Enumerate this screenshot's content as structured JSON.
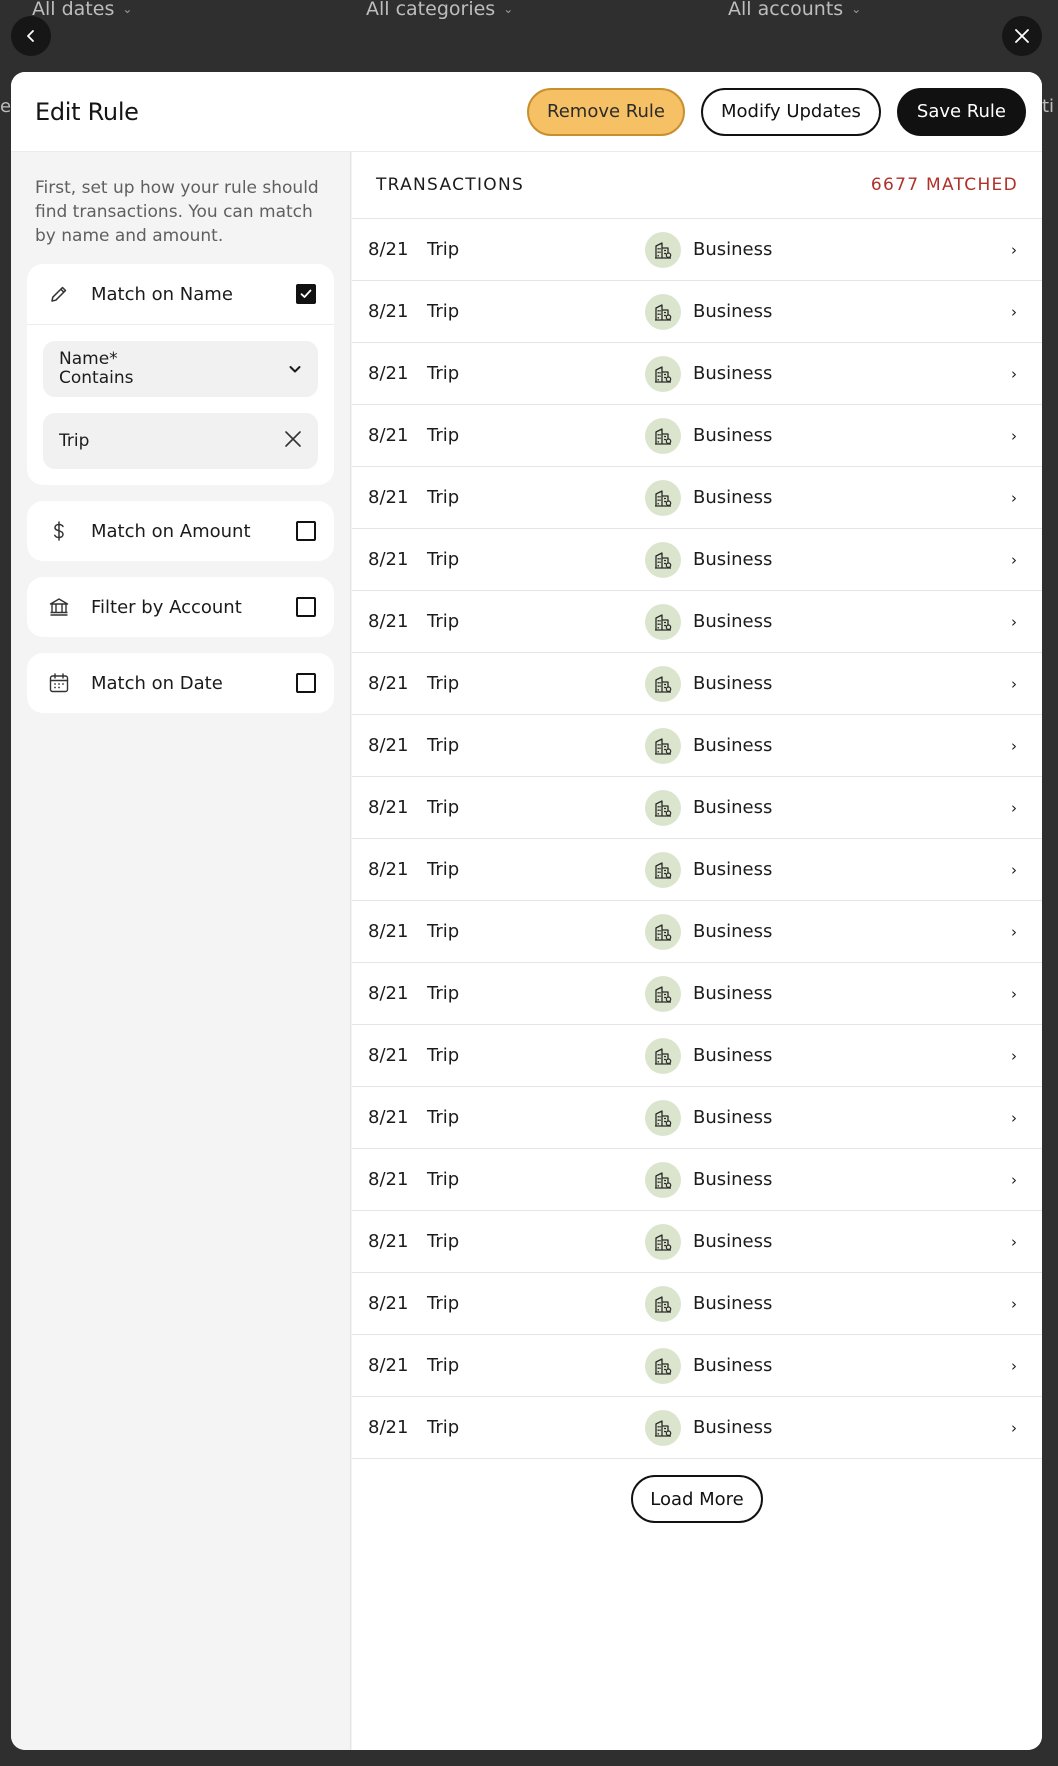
{
  "background": {
    "filters": [
      "All dates",
      "All categories",
      "All accounts"
    ],
    "left_edge_text": "e",
    "right_edge_text": "ti"
  },
  "modal": {
    "title": "Edit Rule",
    "buttons": {
      "remove": "Remove Rule",
      "modify": "Modify Updates",
      "save": "Save Rule"
    },
    "intro": "First, set up how your rule should find transactions. You can match by name and amount.",
    "match_name": {
      "label": "Match on Name",
      "checked": true,
      "select_line1": "Name*",
      "select_line2": "Contains",
      "value": "Trip"
    },
    "match_amount": {
      "label": "Match on Amount",
      "checked": false
    },
    "filter_account": {
      "label": "Filter by Account",
      "checked": false
    },
    "match_date": {
      "label": "Match on Date",
      "checked": false
    }
  },
  "transactions": {
    "title": "TRANSACTIONS",
    "count": "6677 MATCHED",
    "rows": [
      {
        "date": "8/21",
        "name": "Trip",
        "category": "Business"
      },
      {
        "date": "8/21",
        "name": "Trip",
        "category": "Business"
      },
      {
        "date": "8/21",
        "name": "Trip",
        "category": "Business"
      },
      {
        "date": "8/21",
        "name": "Trip",
        "category": "Business"
      },
      {
        "date": "8/21",
        "name": "Trip",
        "category": "Business"
      },
      {
        "date": "8/21",
        "name": "Trip",
        "category": "Business"
      },
      {
        "date": "8/21",
        "name": "Trip",
        "category": "Business"
      },
      {
        "date": "8/21",
        "name": "Trip",
        "category": "Business"
      },
      {
        "date": "8/21",
        "name": "Trip",
        "category": "Business"
      },
      {
        "date": "8/21",
        "name": "Trip",
        "category": "Business"
      },
      {
        "date": "8/21",
        "name": "Trip",
        "category": "Business"
      },
      {
        "date": "8/21",
        "name": "Trip",
        "category": "Business"
      },
      {
        "date": "8/21",
        "name": "Trip",
        "category": "Business"
      },
      {
        "date": "8/21",
        "name": "Trip",
        "category": "Business"
      },
      {
        "date": "8/21",
        "name": "Trip",
        "category": "Business"
      },
      {
        "date": "8/21",
        "name": "Trip",
        "category": "Business"
      },
      {
        "date": "8/21",
        "name": "Trip",
        "category": "Business"
      },
      {
        "date": "8/21",
        "name": "Trip",
        "category": "Business"
      },
      {
        "date": "8/21",
        "name": "Trip",
        "category": "Business"
      },
      {
        "date": "8/21",
        "name": "Trip",
        "category": "Business"
      }
    ],
    "load_more": "Load More"
  },
  "icons": {
    "back": "chevron-left-icon",
    "close": "close-icon",
    "name": "pencil-icon",
    "amount": "dollar-icon",
    "account": "bank-icon",
    "date": "calendar-icon",
    "category": "building-icon"
  },
  "colors": {
    "remove_button": "#f6c165",
    "matched_count": "#b0302a",
    "category_icon_bg": "#dbe5cd"
  }
}
